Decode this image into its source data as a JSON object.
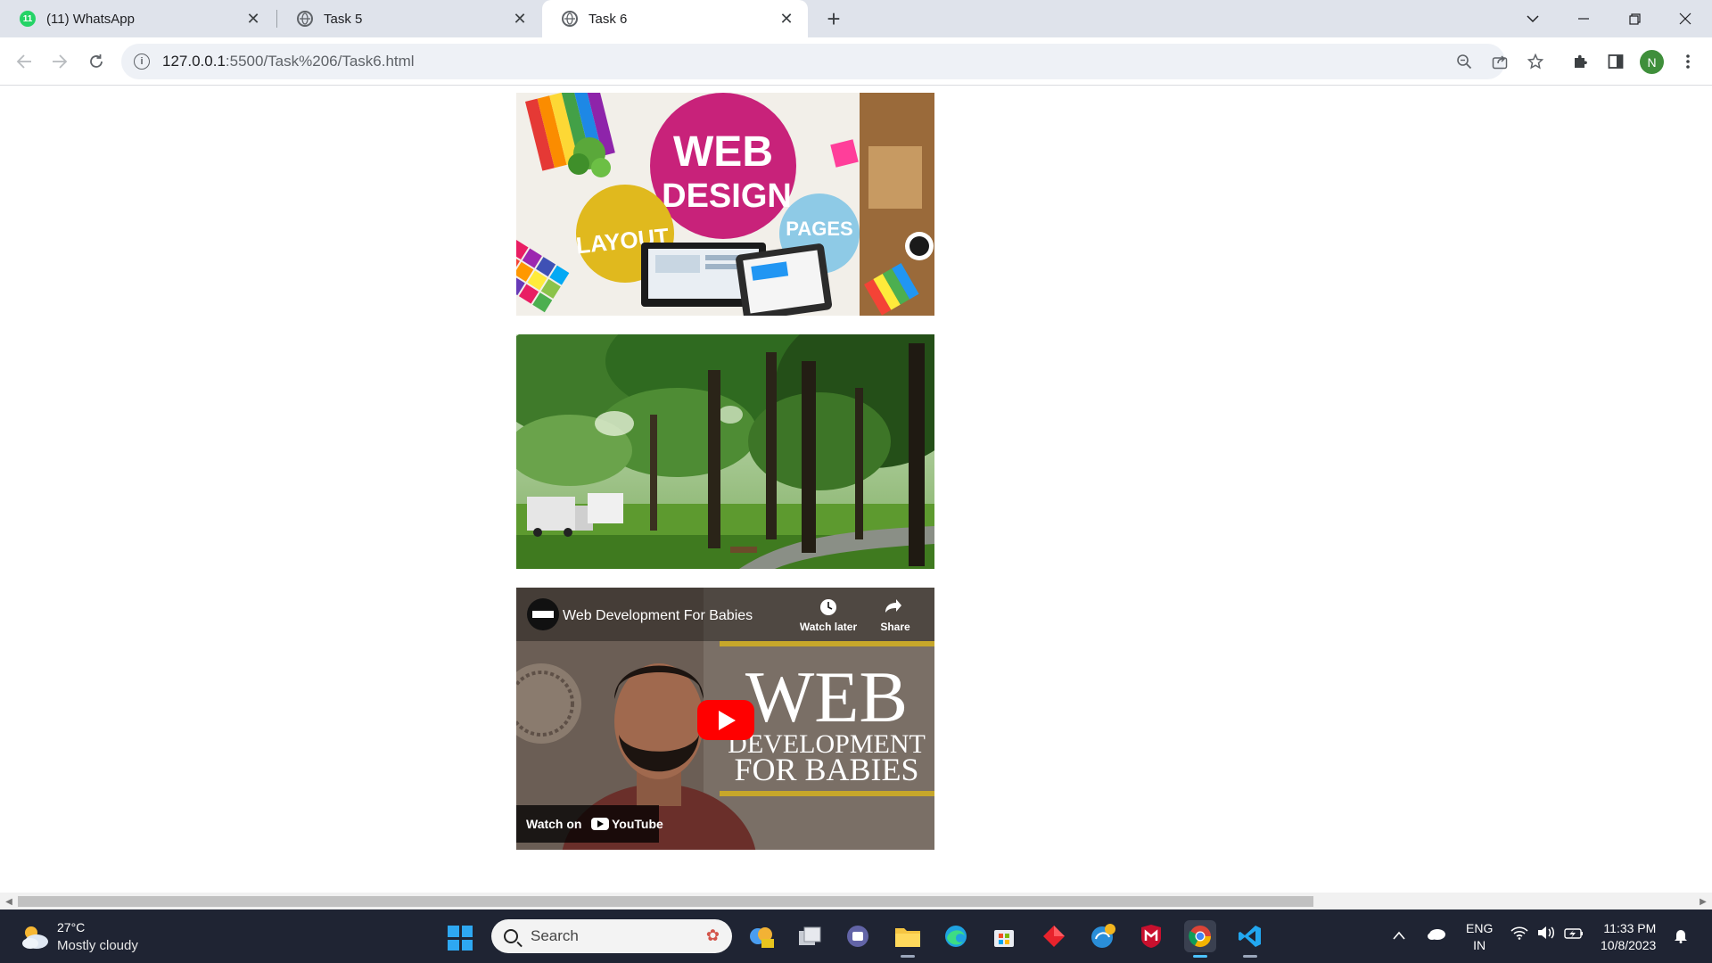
{
  "tabs": [
    {
      "title": "(11) WhatsApp",
      "badge": "11",
      "active": false
    },
    {
      "title": "Task 5",
      "active": false
    },
    {
      "title": "Task 6",
      "active": true
    }
  ],
  "address": {
    "host": "127.0.0.1",
    "path": ":5500/Task%206/Task6.html"
  },
  "profile": {
    "initial": "N"
  },
  "page": {
    "webdesign_image": {
      "main_text_1": "WEB",
      "main_text_2": "DESIGN",
      "layout_text": "LAYOUT",
      "pages_text": "PAGES"
    },
    "video": {
      "title": "Web Development For Babies",
      "watch_later": "Watch later",
      "share": "Share",
      "thumb_big": "WEB",
      "thumb_line2": "DEVELOPMENT",
      "thumb_line3": "FOR BABIES",
      "watch_on": "Watch on",
      "youtube": "YouTube"
    }
  },
  "taskbar": {
    "weather": {
      "temp": "27°C",
      "desc": "Mostly cloudy"
    },
    "search_label": "Search",
    "lang_line1": "ENG",
    "lang_line2": "IN",
    "time": "11:33 PM",
    "date": "10/8/2023"
  },
  "colors": {
    "tab_strip": "#dfe3eb",
    "taskbar": "#1f2433",
    "youtube_red": "#ff0000",
    "whatsapp_green": "#25d366"
  }
}
